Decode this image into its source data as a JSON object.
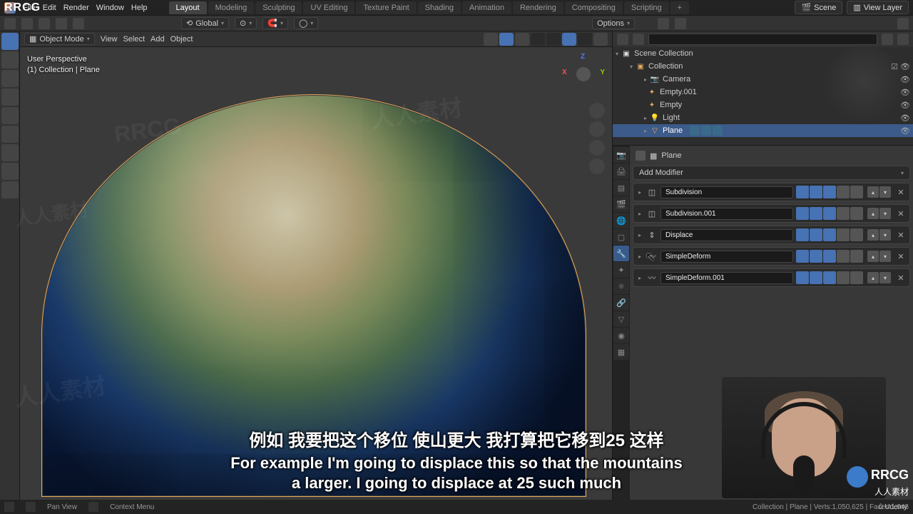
{
  "menubar": {
    "items": [
      "File",
      "Edit",
      "Render",
      "Window",
      "Help"
    ],
    "workspaces": [
      "Layout",
      "Modeling",
      "Sculpting",
      "UV Editing",
      "Texture Paint",
      "Shading",
      "Animation",
      "Rendering",
      "Compositing",
      "Scripting"
    ],
    "active_ws": "Layout",
    "scene_label": "Scene",
    "viewlayer_label": "View Layer"
  },
  "toolrow": {
    "orientation": "Global",
    "options": "Options"
  },
  "viewport": {
    "mode": "Object Mode",
    "menus": [
      "View",
      "Select",
      "Add",
      "Object"
    ],
    "overlay_line1": "User Perspective",
    "overlay_line2": "(1) Collection | Plane",
    "axes": {
      "x": "X",
      "y": "Y",
      "z": "Z"
    }
  },
  "outliner": {
    "scene": "Scene Collection",
    "collection": "Collection",
    "items": [
      {
        "name": "Camera",
        "icon": "camera"
      },
      {
        "name": "Empty.001",
        "icon": "empty"
      },
      {
        "name": "Empty",
        "icon": "empty"
      },
      {
        "name": "Light",
        "icon": "light"
      },
      {
        "name": "Plane",
        "icon": "mesh",
        "selected": true
      }
    ]
  },
  "properties": {
    "context_label": "Plane",
    "add_modifier": "Add Modifier",
    "modifiers": [
      {
        "name": "Subdivision",
        "icon": "subdiv"
      },
      {
        "name": "Subdivision.001",
        "icon": "subdiv"
      },
      {
        "name": "Displace",
        "icon": "displace"
      },
      {
        "name": "SimpleDeform",
        "icon": "deform"
      },
      {
        "name": "SimpleDeform.001",
        "icon": "deform"
      }
    ]
  },
  "statusbar": {
    "pan": "Pan View",
    "context": "Context Menu",
    "info": "Collection | Plane | Verts:1,050,625 | Faces:1,048"
  },
  "subtitles": {
    "zh": "例如 我要把这个移位 使山更大 我打算把它移到25 这样",
    "en1": "For example I'm going to displace this so that the mountains",
    "en2": "a larger. I going to displace at 25 such much"
  },
  "branding": {
    "tl": "RRCG",
    "br_main": "RRCG",
    "br_sub": "人人素材",
    "udemy": "Udemy"
  }
}
